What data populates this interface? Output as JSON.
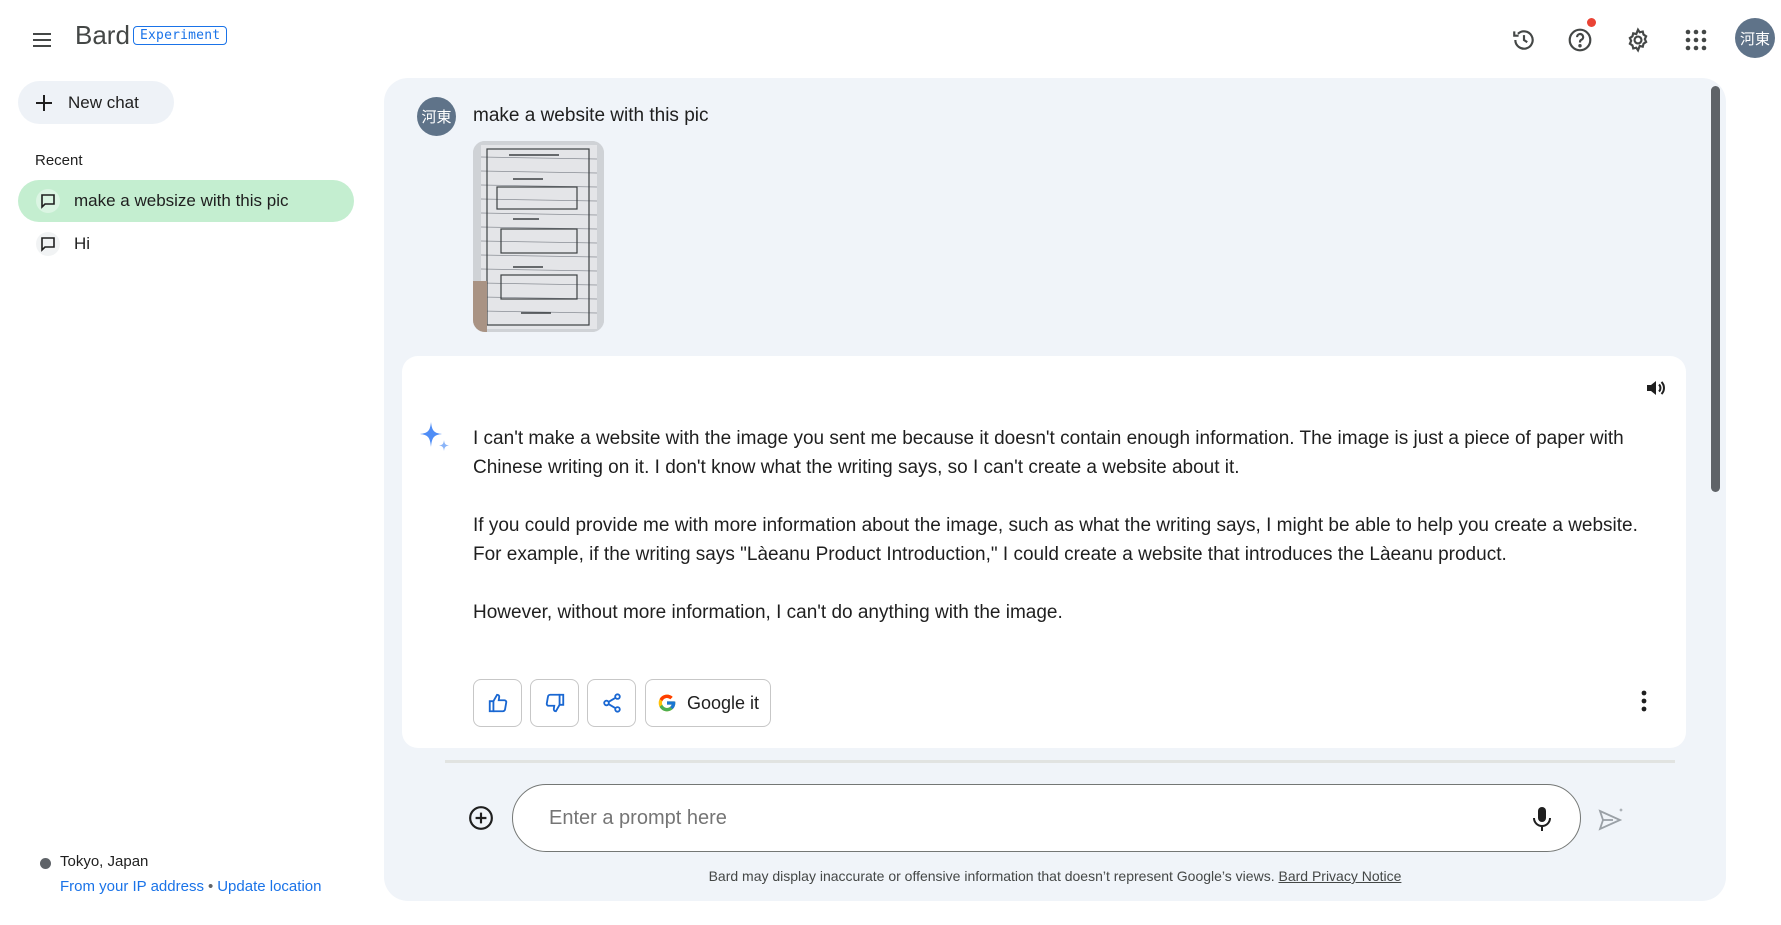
{
  "header": {
    "logo": "Bard",
    "badge": "Experiment",
    "account_initials": "河東",
    "icons": [
      "menu-icon",
      "history-icon",
      "help-icon",
      "settings-icon",
      "apps-icon"
    ]
  },
  "sidebar": {
    "new_chat": "New chat",
    "recent_heading": "Recent",
    "items": [
      {
        "label": "make a websize with this pic",
        "selected": true
      },
      {
        "label": "Hi",
        "selected": false
      }
    ],
    "location": {
      "place": "Tokyo, Japan",
      "source": "From your IP address",
      "separator": "•",
      "update": "Update location"
    }
  },
  "conversation": {
    "user_initials": "河東",
    "prompt": "make a website with this pic",
    "response": [
      "I can't make a website with the image you sent me because it doesn't contain enough information. The image is just a piece of paper with Chinese writing on it. I don't know what the writing says, so I can't create a website about it.",
      "If you could provide me with more information about the image, such as what the writing says, I might be able to help you create a website. For example, if the writing says \"Làeanu Product Introduction,\" I could create a website that introduces the Làeanu product.",
      "However, without more information, I can't do anything with the image."
    ],
    "google_it": "Google it"
  },
  "input": {
    "placeholder": "Enter a prompt here"
  },
  "footer": {
    "disclaimer": "Bard may display inaccurate or offensive information that doesn’t represent Google’s views.",
    "privacy_link": "Bard Privacy Notice"
  },
  "colors": {
    "accent": "#1a73e8",
    "selected_item": "#c4eed0",
    "panel_bg": "#f0f4f9",
    "notification_dot": "#ea4335"
  }
}
